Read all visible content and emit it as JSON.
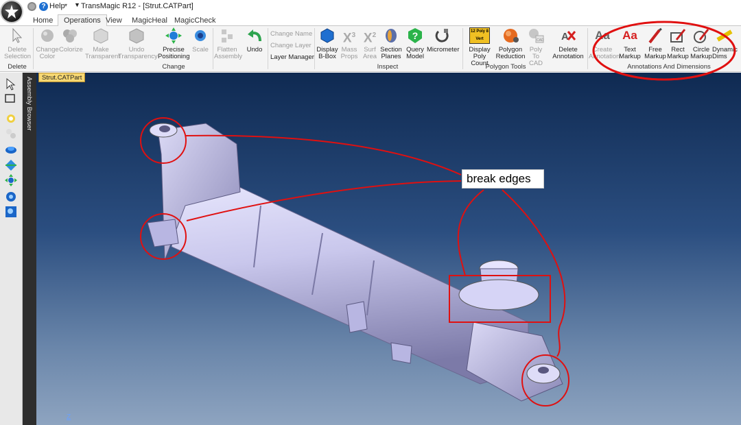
{
  "window": {
    "help_label": "Help",
    "help_dropdown": "▾",
    "title_marker": "▼",
    "title": "TransMagic R12 - [Strut.CATPart]"
  },
  "tabs": [
    {
      "label": "Home",
      "active": false
    },
    {
      "label": "Operations",
      "active": true
    },
    {
      "label": "View",
      "active": false
    },
    {
      "label": "MagicHeal",
      "active": false
    },
    {
      "label": "MagicCheck",
      "active": false
    }
  ],
  "ribbon": {
    "delete": {
      "delete_selection": "Delete Selection",
      "group": "Delete"
    },
    "change": {
      "change_color": "Change Color",
      "colorize": "Colorize",
      "make_transparent": "Make Transparent",
      "undo_transparency": "Undo Transparency",
      "precise_positioning": "Precise Positioning",
      "scale": "Scale",
      "group": "Change"
    },
    "assembly": {
      "flatten_assembly": "Flatten Assembly",
      "undo": "Undo"
    },
    "layers": {
      "change_name": "Change Name",
      "change_layer": "Change Layer",
      "layer_manager": "Layer Manager"
    },
    "inspect": {
      "display_bbox": "Display B-Box",
      "mass_props": "Mass Props",
      "surf_area": "Surf Area",
      "section_planes": "Section Planes",
      "query_model": "Query Model",
      "micrometer": "Micrometer",
      "group": "Inspect"
    },
    "polygon": {
      "display_poly_count": "Display Poly Count",
      "polygon_reduction": "Polygon Reduction",
      "poly_to_cad": "Poly To CAD",
      "delete_annotation": "Delete Annotation",
      "group": "Polygon Tools"
    },
    "annotations": {
      "create_annotation": "Create Annotation",
      "text_markup": "Text Markup",
      "free_markup": "Free Markup",
      "rect_markup": "Rect Markup",
      "circle_markup": "Circle Markup",
      "dynamic_dims": "Dynamic Dims",
      "group": "Annotations And Dimensions"
    },
    "icon_texts": {
      "x3": "X",
      "x3_sup": "3",
      "x2": "X",
      "x2_sup": "2",
      "poly_badge": "12 Poly 8 Vert",
      "cad_badge": "CAD",
      "aa": "Aa",
      "aa2": "Aa"
    }
  },
  "side": {
    "assembly_browser": "Assembly Browser"
  },
  "viewport": {
    "doc_tab": "Strut.CATPart",
    "callout": "break edges",
    "axis_label": "Z"
  },
  "colors": {
    "markup_red": "#e01010",
    "doc_tab": "#f7d872",
    "viewport_top": "#0f2a52",
    "viewport_bottom": "#8ea4c0",
    "part_body": "#c9c7ec"
  }
}
